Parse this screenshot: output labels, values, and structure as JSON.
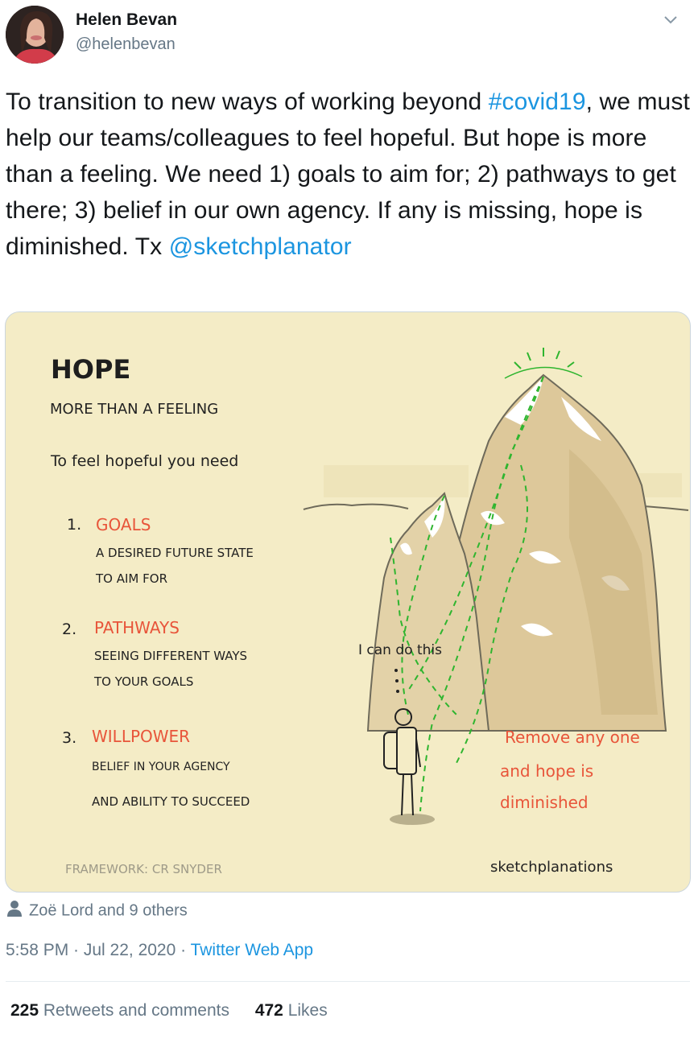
{
  "author": {
    "name": "Helen Bevan",
    "handle": "@helenbevan"
  },
  "tweet": {
    "line1_pre": "To transition to new ways of working beyond ",
    "hashtag": "#covid19",
    "line1_post": ",",
    "body": " we must help our teams/colleagues to feel hopeful. But hope is more than a feeling.  We need 1) goals to aim for; 2) pathways to get there; 3) belief in our own agency. If any is missing, hope is diminished. Tx ",
    "mention": "@sketchplanator"
  },
  "image": {
    "title": "HOPE",
    "subtitle": "MORE THAN A FEELING",
    "intro": "To feel hopeful you need",
    "items": [
      {
        "num": "1.",
        "heading": "GOALS",
        "line1": "A DESIRED FUTURE STATE",
        "line2": "TO AIM FOR"
      },
      {
        "num": "2.",
        "heading": "PATHWAYS",
        "line1": "SEEING DIFFERENT WAYS",
        "line2": "TO YOUR GOALS"
      },
      {
        "num": "3.",
        "heading": "WILLPOWER",
        "line1": "BELIEF IN YOUR AGENCY",
        "line2": "AND ABILITY TO SUCCEED"
      }
    ],
    "thought": "I can do this",
    "warning": [
      "Remove any one",
      "and hope is",
      "diminished"
    ],
    "credit": "FRAMEWORK: CR SNYDER",
    "brand": "sketchplanations",
    "colors": {
      "background": "#f4ecc6",
      "accent": "#e8553a",
      "path": "#2fb52f"
    }
  },
  "likers": "Zoë Lord and 9 others",
  "meta": {
    "time": "5:58 PM · Jul 22, 2020 · ",
    "source": "Twitter Web App"
  },
  "stats": {
    "retweets_count": "225",
    "retweets_label": " Retweets and comments",
    "likes_count": "472",
    "likes_label": " Likes"
  },
  "icons": {
    "caret": "chevron-down-icon",
    "person": "person-icon"
  }
}
